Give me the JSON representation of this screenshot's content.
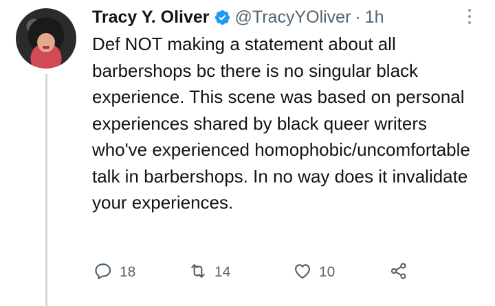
{
  "tweet": {
    "author": {
      "display_name": "Tracy Y. Oliver",
      "handle": "@TracyYOliver",
      "verified": true,
      "avatar": "profile-photo"
    },
    "separator": "·",
    "timestamp": "1h",
    "text": "Def NOT making a statement about all barbershops bc there is no singular black experience. This scene was based on personal experiences shared by black queer writers who've experienced homophobic/uncomfortable talk in barbershops. In no way does it invalidate your experiences.",
    "actions": {
      "reply": {
        "icon": "reply-icon",
        "count": "18"
      },
      "retweet": {
        "icon": "retweet-icon",
        "count": "14"
      },
      "like": {
        "icon": "heart-icon",
        "count": "10"
      },
      "share": {
        "icon": "share-icon"
      }
    },
    "more_icon": "more-options-icon"
  },
  "colors": {
    "text": "#0f1419",
    "secondary_text": "#536471",
    "verified": "#1d9bf0",
    "thread_line": "#cfd9de"
  }
}
